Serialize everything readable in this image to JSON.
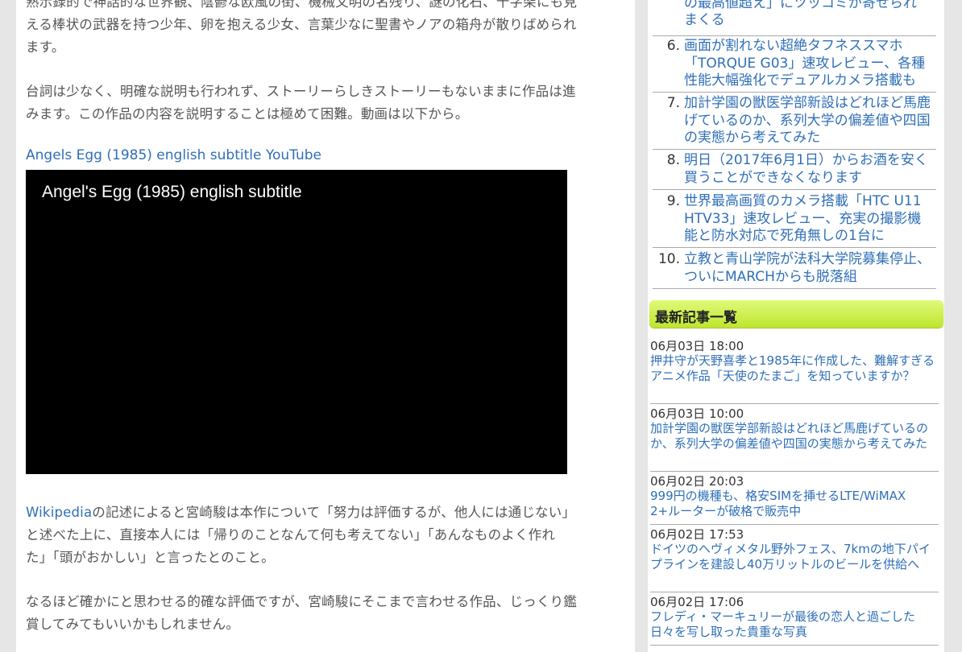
{
  "article": {
    "para1_line1": "熟示録的で神話的な世界観、陰鬱な欧風の街、機械文明の名残り、謎の化石、十字架にも見",
    "para1_line2": "える棒状の武器を持つ少年、卵を抱える少女、言葉少なに聖書やノアの箱舟が散りばめられ",
    "para1_line3": "ます。",
    "para2_line1": "台詞は少なく、明確な説明も行われず、ストーリーらしきストーリーもないままに作品は進",
    "para2_line2": "みます。この作品の内容を説明することは極めて困難。動画は以下から。",
    "video_link": "Angels Egg (1985) english subtitle YouTube",
    "video_title": "Angel's Egg (1985) english subtitle",
    "para3_link": "Wikipedia",
    "para3_line1_rest": "の記述によると宮崎駿は本作について「努力は評価するが、他人には通じない」",
    "para3_line2": "と述べた上に、直接本人には「帰りのことなんて何も考えてない」「あんなものよく作れ",
    "para3_line3": "た」「頭がおかしい」と言ったとのこと。",
    "para4_line1": "なるほど確かにと思わせる的確な評価ですが、宮崎駿にそこまで言わせる作品、じっくり鑑",
    "para4_line2": "賞してみてもいいかもしれません。"
  },
  "ranking": {
    "top_partial_line1": "の最高値超え」にツッコミが寄せられ",
    "top_partial_line2": "まくる",
    "items": [
      {
        "num": "6.",
        "title": "画面が割れない超絶タフネススマホ「TORQUE G03」速攻レビュー、各種性能大幅強化でデュアルカメラ搭載も"
      },
      {
        "num": "7.",
        "title": "加計学園の獣医学部新設はどれほど馬鹿げているのか、系列大学の偏差値や四国の実態から考えてみた"
      },
      {
        "num": "8.",
        "title": "明日（2017年6月1日）からお酒を安く買うことができなくなります"
      },
      {
        "num": "9.",
        "title": "世界最高画質のカメラ搭載「HTC U11 HTV33」速攻レビュー、充実の撮影機能と防水対応で死角無しの1台に"
      },
      {
        "num": "10.",
        "title": "立教と青山学院が法科大学院募集停止、ついにMARCHからも脱落組"
      }
    ]
  },
  "latest": {
    "heading": "最新記事一覧",
    "items": [
      {
        "date": "06月03日 18:00",
        "title": "押井守が天野喜孝と1985年に作成した、難解すぎるアニメ作品「天使のたまご」を知っていますか？"
      },
      {
        "date": "06月03日 10:00",
        "title": "加計学園の獣医学部新設はどれほど馬鹿げているのか、系列大学の偏差値や四国の実態から考えてみた"
      },
      {
        "date": "06月02日 20:03",
        "title": "999円の機種も、格安SIMを挿せるLTE/WiMAX 2+ルーターが破格で販売中"
      },
      {
        "date": "06月02日 17:53",
        "title": "ドイツのヘヴィメタル野外フェス、7kmの地下パイプラインを建設し40万リットルのビールを供給へ"
      },
      {
        "date": "06月02日 17:06",
        "title": "フレディ・マーキュリーが最後の恋人と過ごした日々を写し取った貴重な写真"
      }
    ]
  },
  "colors": {
    "link": "#2f6fb7",
    "section_head": "#c8ee3c"
  }
}
